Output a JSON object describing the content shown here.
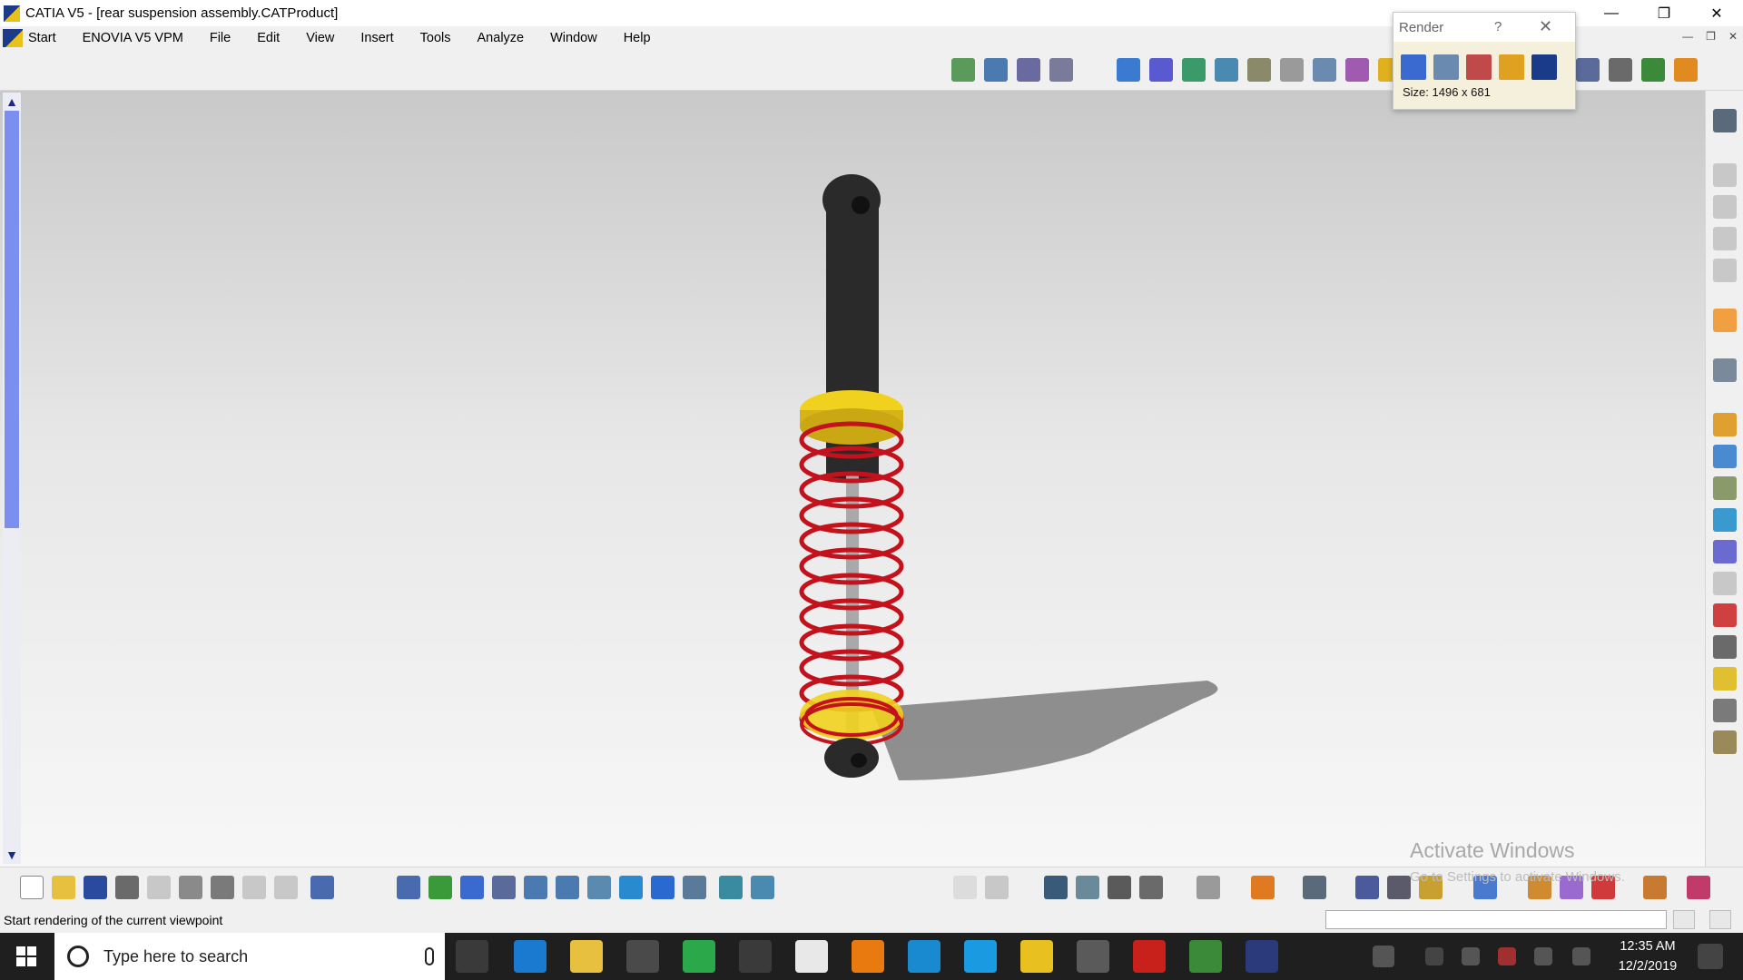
{
  "window": {
    "title": "CATIA V5 - [rear suspension assembly.CATProduct]"
  },
  "menu": {
    "items": [
      "Start",
      "ENOVIA V5 VPM",
      "File",
      "Edit",
      "View",
      "Insert",
      "Tools",
      "Analyze",
      "Window",
      "Help"
    ]
  },
  "render_dialog": {
    "title": "Render",
    "help": "?",
    "size_text": "Size: 1496 x 681"
  },
  "status": {
    "message": "Start rendering of the current viewpoint"
  },
  "watermark": {
    "title": "Activate Windows",
    "subtitle": "Go to Settings to activate Windows."
  },
  "taskbar": {
    "search_placeholder": "Type here to search",
    "time": "12:35 AM",
    "date": "12/2/2019"
  },
  "colors": {
    "spring": "#c3121c",
    "spring_seat": "#f0d21e",
    "damper_body": "#2a2a2a",
    "rod": "#a9a9a9",
    "scrollbar_thumb": "#7b8ff0"
  }
}
